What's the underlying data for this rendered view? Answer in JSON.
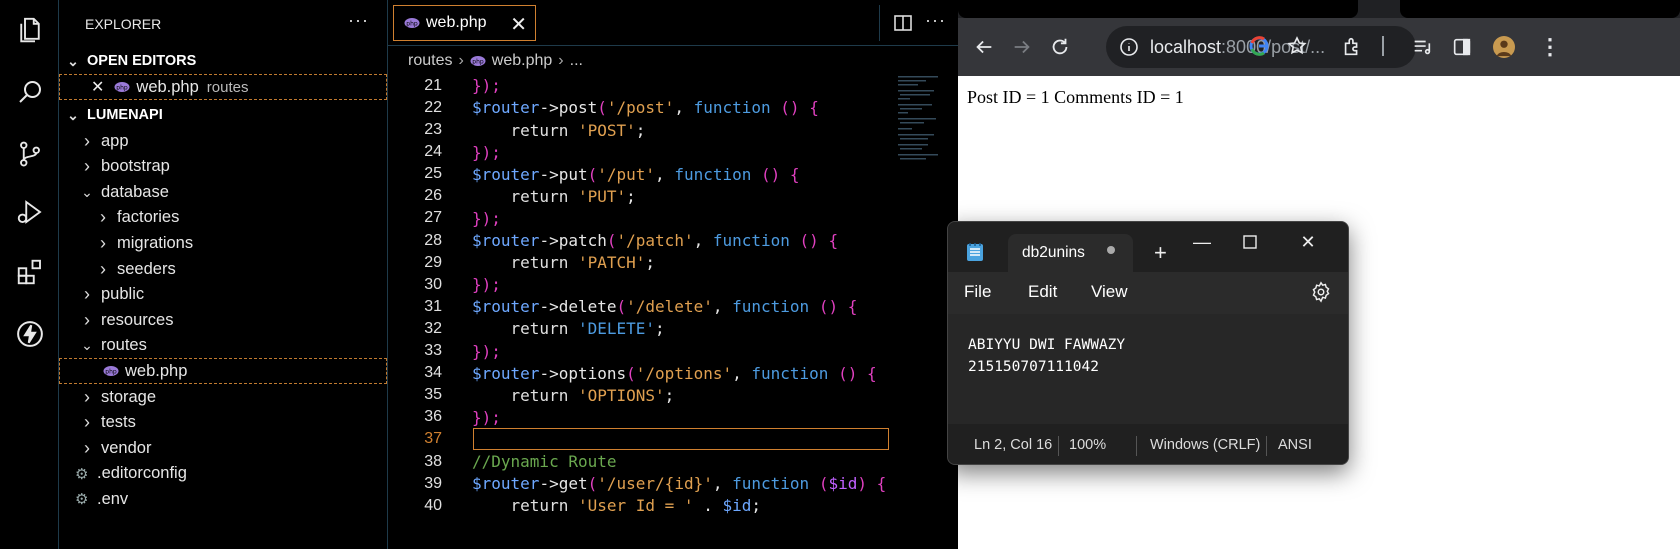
{
  "vscode": {
    "explorer": {
      "title": "EXPLORER",
      "more": "···",
      "open_editors_label": "OPEN EDITORS",
      "open_editor_file": "web.php",
      "open_editor_folder": "routes",
      "project_label": "LUMENAPI",
      "tree": [
        {
          "label": "app",
          "type": "folder",
          "expanded": false
        },
        {
          "label": "bootstrap",
          "type": "folder",
          "expanded": false
        },
        {
          "label": "database",
          "type": "folder",
          "expanded": true
        },
        {
          "label": "factories",
          "type": "folder",
          "expanded": false
        },
        {
          "label": "migrations",
          "type": "folder",
          "expanded": false
        },
        {
          "label": "seeders",
          "type": "folder",
          "expanded": false
        },
        {
          "label": "public",
          "type": "folder",
          "expanded": false
        },
        {
          "label": "resources",
          "type": "folder",
          "expanded": false
        },
        {
          "label": "routes",
          "type": "folder",
          "expanded": true
        },
        {
          "label": "web.php",
          "type": "php-file",
          "expanded": false
        },
        {
          "label": "storage",
          "type": "folder",
          "expanded": false
        },
        {
          "label": "tests",
          "type": "folder",
          "expanded": false
        },
        {
          "label": "vendor",
          "type": "folder",
          "expanded": false
        },
        {
          "label": ".editorconfig",
          "type": "config-file",
          "expanded": false
        },
        {
          "label": ".env",
          "type": "config-file",
          "expanded": false
        }
      ]
    },
    "editor": {
      "tab_label": "web.php",
      "breadcrumb": [
        "routes",
        "web.php",
        "..."
      ],
      "active_line": "37",
      "lines": [
        {
          "n": "21",
          "parts": [
            [
              "brace",
              "});"
            ]
          ]
        },
        {
          "n": "22",
          "parts": [
            [
              "var",
              "$router"
            ],
            [
              "plain",
              "->post"
            ],
            [
              "paren",
              "("
            ],
            [
              "str",
              "'/post'"
            ],
            [
              "plain",
              ", "
            ],
            [
              "kw",
              "function"
            ],
            [
              "plain",
              " "
            ],
            [
              "paren",
              "()"
            ],
            [
              "plain",
              " "
            ],
            [
              "brace",
              "{"
            ]
          ]
        },
        {
          "n": "23",
          "parts": [
            [
              "plain",
              "    "
            ],
            [
              "ret",
              "return"
            ],
            [
              "plain",
              " "
            ],
            [
              "str",
              "'POST'"
            ],
            [
              "plain",
              ";"
            ]
          ]
        },
        {
          "n": "24",
          "parts": [
            [
              "brace",
              "});"
            ]
          ]
        },
        {
          "n": "25",
          "parts": [
            [
              "var",
              "$router"
            ],
            [
              "plain",
              "->put"
            ],
            [
              "paren",
              "("
            ],
            [
              "str",
              "'/put'"
            ],
            [
              "plain",
              ", "
            ],
            [
              "kw",
              "function"
            ],
            [
              "plain",
              " "
            ],
            [
              "paren",
              "()"
            ],
            [
              "plain",
              " "
            ],
            [
              "brace",
              "{"
            ]
          ]
        },
        {
          "n": "26",
          "parts": [
            [
              "plain",
              "    "
            ],
            [
              "ret",
              "return"
            ],
            [
              "plain",
              " "
            ],
            [
              "str",
              "'PUT'"
            ],
            [
              "plain",
              ";"
            ]
          ]
        },
        {
          "n": "27",
          "parts": [
            [
              "brace",
              "});"
            ]
          ]
        },
        {
          "n": "28",
          "parts": [
            [
              "var",
              "$router"
            ],
            [
              "plain",
              "->patch"
            ],
            [
              "paren",
              "("
            ],
            [
              "str",
              "'/patch'"
            ],
            [
              "plain",
              ", "
            ],
            [
              "kw",
              "function"
            ],
            [
              "plain",
              " "
            ],
            [
              "paren",
              "()"
            ],
            [
              "plain",
              " "
            ],
            [
              "brace",
              "{"
            ]
          ]
        },
        {
          "n": "29",
          "parts": [
            [
              "plain",
              "    "
            ],
            [
              "ret",
              "return"
            ],
            [
              "plain",
              " "
            ],
            [
              "str",
              "'PATCH'"
            ],
            [
              "plain",
              ";"
            ]
          ]
        },
        {
          "n": "30",
          "parts": [
            [
              "brace",
              "});"
            ]
          ]
        },
        {
          "n": "31",
          "parts": [
            [
              "var",
              "$router"
            ],
            [
              "plain",
              "->delete"
            ],
            [
              "paren",
              "("
            ],
            [
              "str",
              "'/delete'"
            ],
            [
              "plain",
              ", "
            ],
            [
              "kw",
              "function"
            ],
            [
              "plain",
              " "
            ],
            [
              "paren",
              "()"
            ],
            [
              "plain",
              " "
            ],
            [
              "brace",
              "{"
            ]
          ]
        },
        {
          "n": "32",
          "parts": [
            [
              "plain",
              "    "
            ],
            [
              "ret",
              "return"
            ],
            [
              "plain",
              " "
            ],
            [
              "kw",
              "'DELETE'"
            ],
            [
              "plain",
              ";"
            ]
          ]
        },
        {
          "n": "33",
          "parts": [
            [
              "brace",
              "});"
            ]
          ]
        },
        {
          "n": "34",
          "parts": [
            [
              "var",
              "$router"
            ],
            [
              "plain",
              "->options"
            ],
            [
              "paren",
              "("
            ],
            [
              "str",
              "'/options'"
            ],
            [
              "plain",
              ", "
            ],
            [
              "kw",
              "function"
            ],
            [
              "plain",
              " "
            ],
            [
              "paren",
              "()"
            ],
            [
              "plain",
              " "
            ],
            [
              "brace",
              "{"
            ]
          ]
        },
        {
          "n": "35",
          "parts": [
            [
              "plain",
              "    "
            ],
            [
              "ret",
              "return"
            ],
            [
              "plain",
              " "
            ],
            [
              "str",
              "'OPTIONS'"
            ],
            [
              "plain",
              ";"
            ]
          ]
        },
        {
          "n": "36",
          "parts": [
            [
              "brace",
              "});"
            ]
          ]
        },
        {
          "n": "37",
          "parts": []
        },
        {
          "n": "38",
          "parts": [
            [
              "com",
              "//Dynamic Route"
            ]
          ]
        },
        {
          "n": "39",
          "parts": [
            [
              "var",
              "$router"
            ],
            [
              "plain",
              "->get"
            ],
            [
              "paren",
              "("
            ],
            [
              "str",
              "'/user/{id}'"
            ],
            [
              "plain",
              ", "
            ],
            [
              "kw",
              "function"
            ],
            [
              "plain",
              " "
            ],
            [
              "paren",
              "("
            ],
            [
              "var2",
              "$id"
            ],
            [
              "paren",
              ")"
            ],
            [
              "plain",
              " "
            ],
            [
              "brace",
              "{"
            ]
          ]
        },
        {
          "n": "40",
          "parts": [
            [
              "plain",
              "    "
            ],
            [
              "ret",
              "return"
            ],
            [
              "plain",
              " "
            ],
            [
              "str",
              "'User Id = '"
            ],
            [
              "plain",
              " . "
            ],
            [
              "var",
              "$id"
            ],
            [
              "plain",
              ";"
            ]
          ]
        }
      ]
    }
  },
  "browser": {
    "url_host": "localhost",
    "url_path": ":8000/post/...",
    "page_text": "Post ID = 1 Comments ID = 1"
  },
  "notepad": {
    "tab_title": "db2unins",
    "menu": [
      "File",
      "Edit",
      "View"
    ],
    "content_line1": "ABIYYU DWI FAWWAZY",
    "content_line2": "215150707111042",
    "status_position": "Ln 2, Col 16",
    "status_zoom": "100%",
    "status_line_ending": "Windows (CRLF)",
    "status_encoding": "ANSI"
  },
  "colors": {
    "accent_orange": "#d08030",
    "vscode_bg": "#000000",
    "browser_toolbar": "#35363a",
    "notepad_bg": "#2b2b2b"
  }
}
